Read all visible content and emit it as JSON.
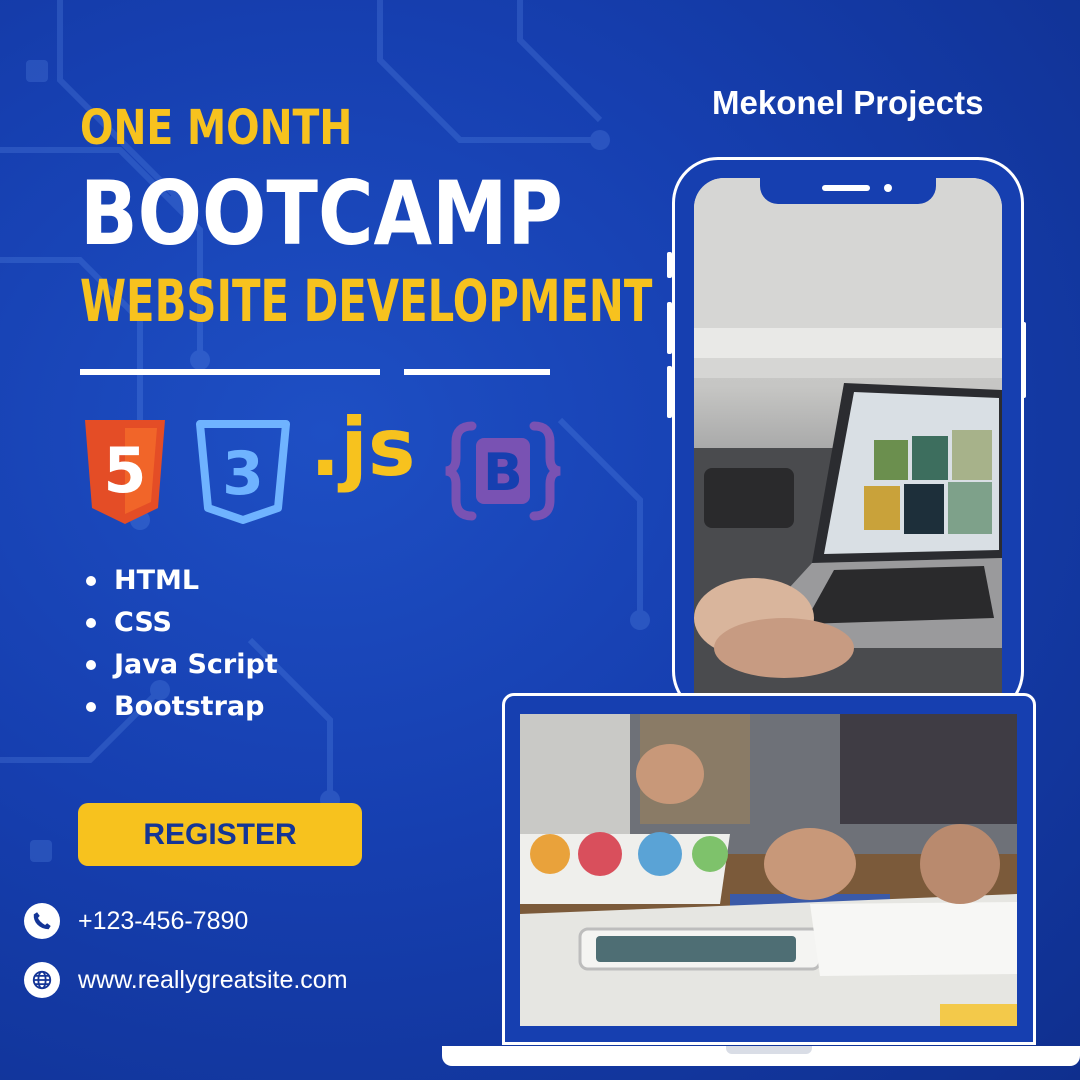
{
  "brand": "Mekonel Projects",
  "headline": {
    "line1": "ONE MONTH",
    "line2": "BOOTCAMP",
    "line3": "WEBSITE DEVELOPMENT"
  },
  "tech_logos": {
    "html5": "5",
    "css3": "3",
    "js": ".js",
    "bootstrap": "B"
  },
  "skills": [
    "HTML",
    "CSS",
    "Java Script",
    "Bootstrap"
  ],
  "cta": {
    "label": "REGISTER"
  },
  "contact": {
    "phone": "+123-456-7890",
    "website": "www.reallygreatsite.com"
  },
  "colors": {
    "background": "#1a45b8",
    "accent_yellow": "#f7c21e",
    "html_orange": "#e44d26",
    "css_blue": "#6fb3ff",
    "bootstrap_purple": "#7952b3",
    "text_white": "#ffffff"
  },
  "icons": {
    "phone": "phone-icon",
    "website": "globe-icon"
  }
}
